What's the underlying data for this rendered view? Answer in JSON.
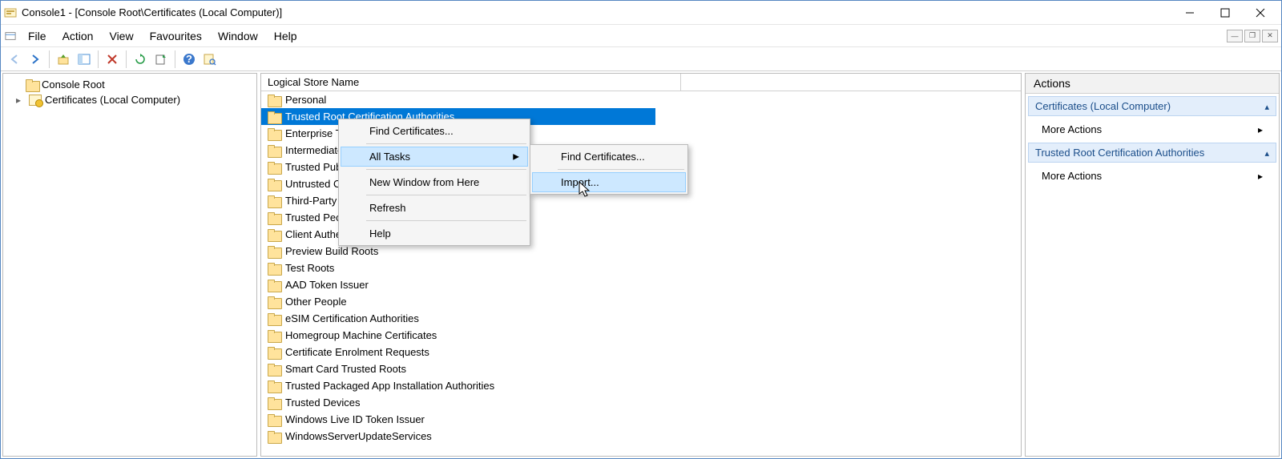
{
  "title": "Console1 - [Console Root\\Certificates (Local Computer)]",
  "menu": {
    "file": "File",
    "action": "Action",
    "view": "View",
    "favourites": "Favourites",
    "window": "Window",
    "help": "Help"
  },
  "tree": {
    "root": "Console Root",
    "child": "Certificates (Local Computer)"
  },
  "column_header": "Logical Store Name",
  "list_items": [
    "Personal",
    "Trusted Root Certification Authorities",
    "Enterprise Trust",
    "Intermediate Certification Authorities",
    "Trusted Publishers",
    "Untrusted Certificates",
    "Third-Party Root Certification Authorities",
    "Trusted People",
    "Client Authentication Issuers",
    "Preview Build Roots",
    "Test Roots",
    "AAD Token Issuer",
    "Other People",
    "eSIM Certification Authorities",
    "Homegroup Machine Certificates",
    "Certificate Enrolment Requests",
    "Smart Card Trusted Roots",
    "Trusted Packaged App Installation Authorities",
    "Trusted Devices",
    "Windows Live ID Token Issuer",
    "WindowsServerUpdateServices"
  ],
  "selected_index": 1,
  "ctx1": {
    "find": "Find Certificates...",
    "all_tasks": "All Tasks",
    "new_window": "New Window from Here",
    "refresh": "Refresh",
    "help": "Help"
  },
  "ctx2": {
    "find": "Find Certificates...",
    "import": "Import..."
  },
  "actions": {
    "title": "Actions",
    "group1": "Certificates (Local Computer)",
    "more1": "More Actions",
    "group2": "Trusted Root Certification Authorities",
    "more2": "More Actions"
  }
}
